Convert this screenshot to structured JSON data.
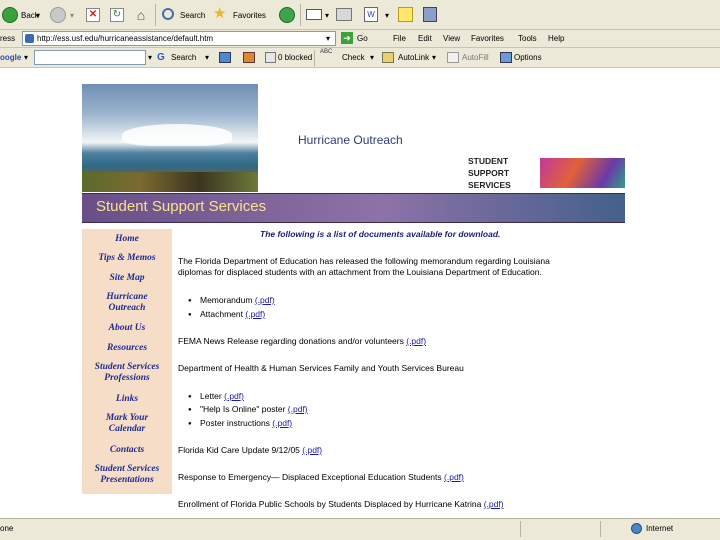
{
  "toolbar": {
    "back_label": "Back",
    "search_label": "Search",
    "favorites_label": "Favorites"
  },
  "addressbar": {
    "label": "ress",
    "url": "http://ess.usf.edu/hurricaneassistance/default.htm",
    "go_label": "Go",
    "menu": [
      "File",
      "Edit",
      "View",
      "Favorites",
      "Tools",
      "Help"
    ]
  },
  "googlebar": {
    "brand": "oogle",
    "search_label": "Search",
    "blocked_label": "0 blocked",
    "check_label": "Check",
    "autolink_label": "AutoLink",
    "autofill_label": "AutoFill",
    "options_label": "Options"
  },
  "page": {
    "outreach_title": "Hurricane Outreach",
    "logo_lines": [
      "STUDENT",
      "SUPPORT",
      "SERVICES"
    ],
    "banner_title": "Student Support Services",
    "nav": [
      {
        "lines": [
          "Home"
        ]
      },
      {
        "lines": [
          "Tips & Memos"
        ]
      },
      {
        "lines": [
          "Site Map"
        ]
      },
      {
        "lines": [
          "Hurricane",
          "Outreach"
        ]
      },
      {
        "lines": [
          "About Us"
        ]
      },
      {
        "lines": [
          "Resources"
        ]
      },
      {
        "lines": [
          "Student Services",
          "Professions"
        ]
      },
      {
        "lines": [
          "Links"
        ]
      },
      {
        "lines": [
          "Mark Your",
          "Calendar"
        ]
      },
      {
        "lines": [
          "Contacts"
        ]
      },
      {
        "lines": [
          "Student Services",
          "Presentations"
        ]
      }
    ],
    "intro": "The following is a list of documents available for download.",
    "para1_line1": "The Florida Department of Education has released the following memorandum regarding Louisiana",
    "para1_line2": "diplomas for displaced students with an attachment from the Louisiana Department of Education.",
    "memo_label": "Memorandum",
    "attachment_label": "Attachment",
    "fema_label": "FEMA News Release regarding donations and/or volunteers",
    "dhhs_label": "Department of Health & Human Services Family and Youth Services Bureau",
    "letter_label": "Letter",
    "poster_label": "\"Help Is Online\" poster",
    "poster_instr_label": "Poster instructions",
    "kidcare_label": "Florida Kid Care Update 9/12/05",
    "response_label": "Response to Emergency— Displaced Exceptional Education Students",
    "enrollment_label": "Enrollment of Florida Public Schools by Students Displaced by Hurricane Katrina",
    "pdf_label": "(.pdf)"
  },
  "status": {
    "left": "one",
    "zone": "Internet"
  },
  "colors": {
    "chrome": "#ece9d8",
    "banner": "#6a4f86",
    "banner_text": "#f7e38d",
    "nav_bg": "#f6ddc8",
    "nav_text": "#1d2d8f",
    "outreach_title": "#2a3c7a",
    "link": "#1a1aa6"
  }
}
